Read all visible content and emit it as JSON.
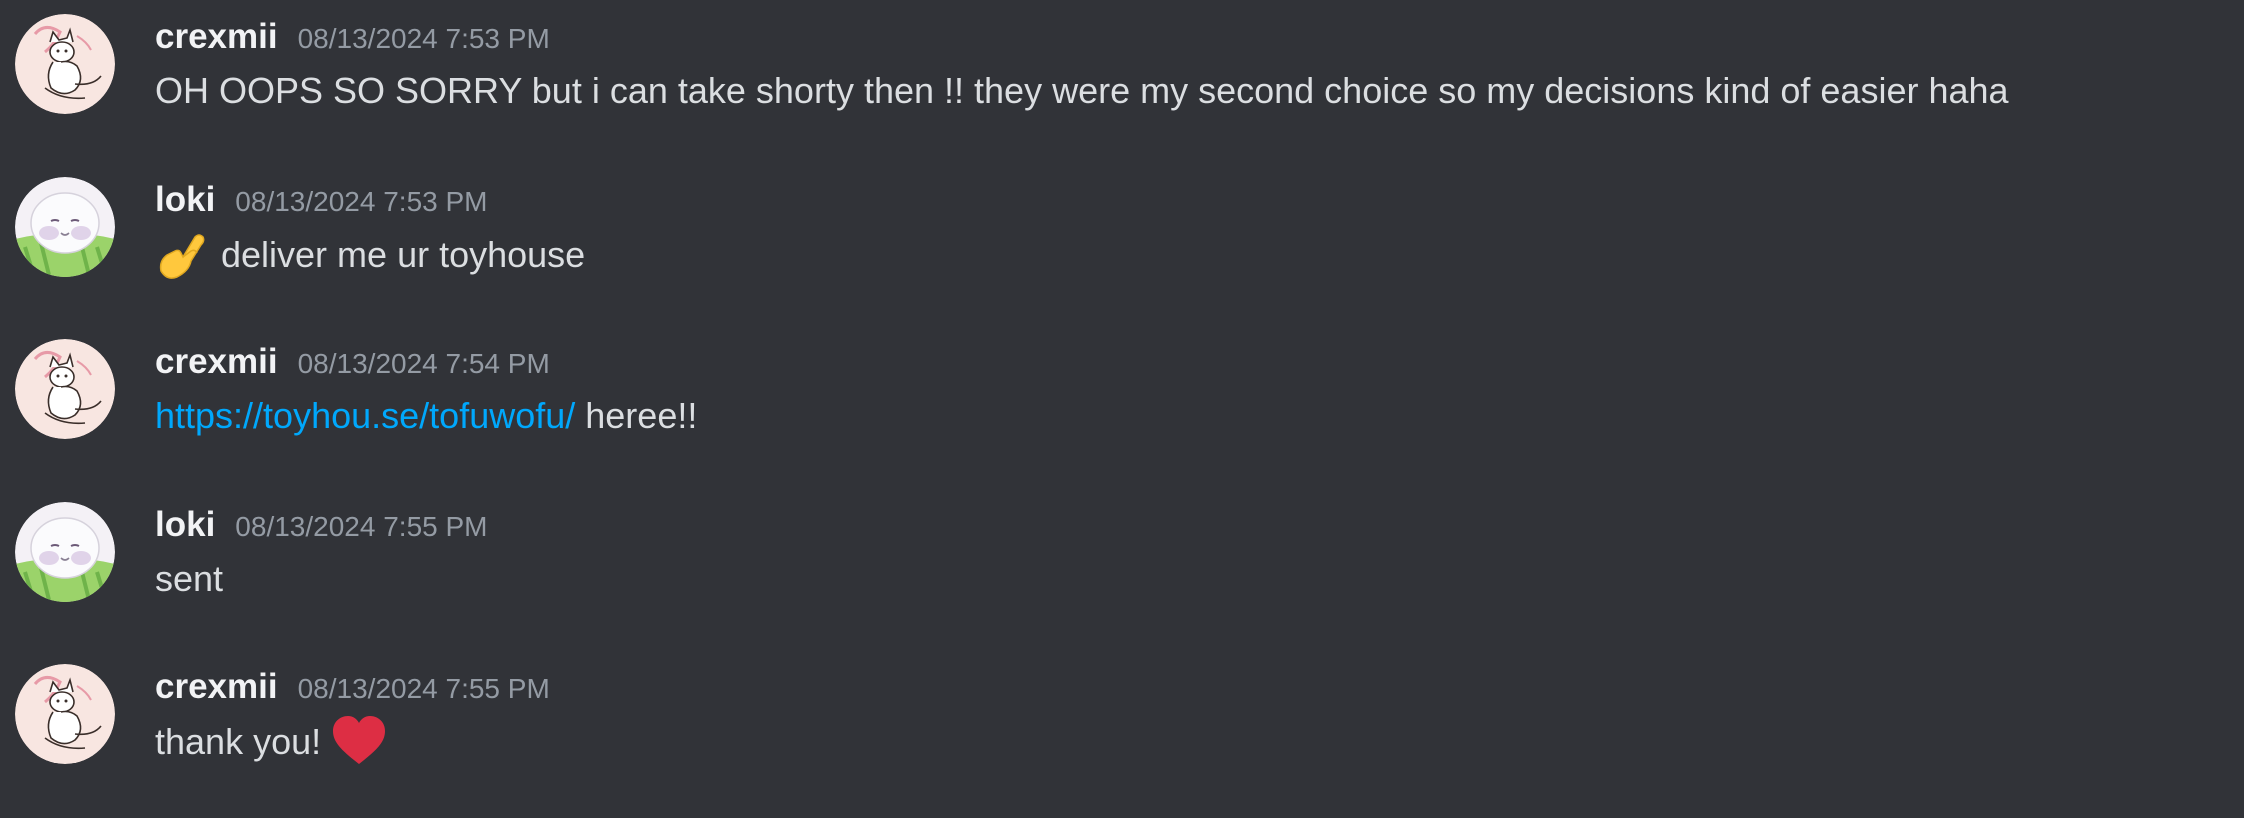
{
  "messages": [
    {
      "author": "crexmii",
      "avatar": "cat-sketch-avatar",
      "timestamp": "08/13/2024 7:53 PM",
      "text": "OH OOPS SO SORRY but i can take shorty then !! they were my second choice so my decisions kind of easier haha"
    },
    {
      "author": "loki",
      "avatar": "seal-avatar",
      "timestamp": "08/13/2024 7:53 PM",
      "emoji": "pinching-hand-emoji",
      "text": "deliver me ur toyhouse"
    },
    {
      "author": "crexmii",
      "avatar": "cat-sketch-avatar",
      "timestamp": "08/13/2024 7:54 PM",
      "link": "https://toyhou.se/tofuwofu/",
      "text": "heree!!"
    },
    {
      "author": "loki",
      "avatar": "seal-avatar",
      "timestamp": "08/13/2024 7:55 PM",
      "text": "sent"
    },
    {
      "author": "crexmii",
      "avatar": "cat-sketch-avatar",
      "timestamp": "08/13/2024 7:55 PM",
      "text": "thank you!",
      "emoji": "red-heart-emoji"
    }
  ],
  "colors": {
    "background": "#313338",
    "username": "#f2f3f5",
    "timestamp": "#949ba4",
    "text": "#dbdee1",
    "link": "#00a8fc",
    "heart": "#dd2e44",
    "pinch_hand": "#ffc83d"
  }
}
